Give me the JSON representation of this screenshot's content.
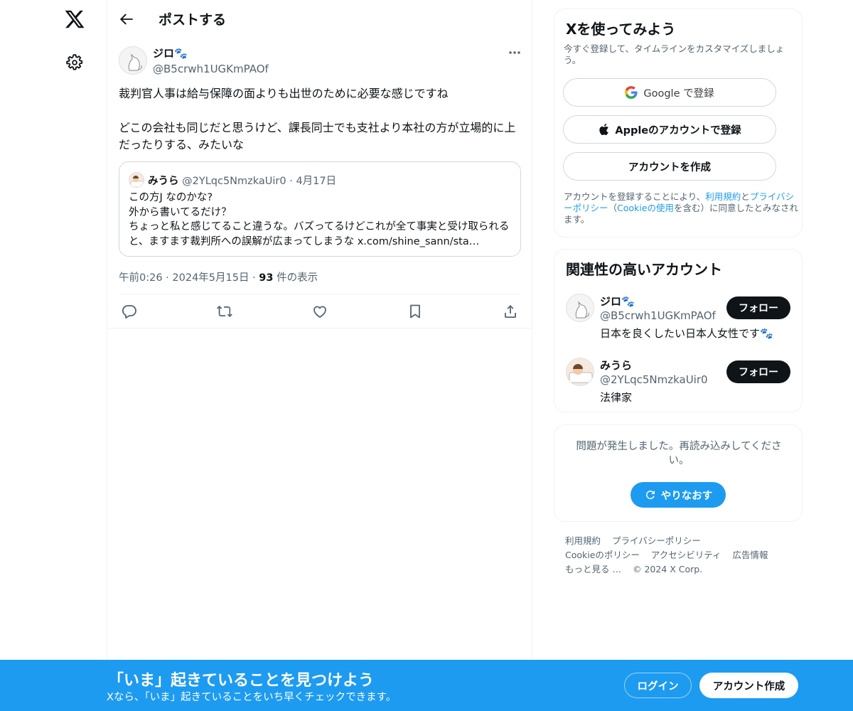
{
  "header": {
    "title": "ポストする"
  },
  "post": {
    "author_name": "ジロ🐾",
    "author_handle": "@B5crwh1UGKmPAOf",
    "text_line1": "裁判官人事は給与保障の面よりも出世のために必要な感じですね",
    "text_line2": "どこの会社も同じだと思うけど、課長同士でも支社より本社の方が立場的に上だったりする、みたいな",
    "quote": {
      "author_name": "みうら",
      "author_handle": "@2YLqc5NmzkaUir0",
      "separator": "·",
      "date": "4月17日",
      "body_line1": "この方J なのかな?",
      "body_line2": "外から書いてるだけ？",
      "body_line3": "ちょっと私と感じてること違うな。バズってるけどこれが全て事実と受け取られると、ますます裁判所への誤解が広まってしまうな x.com/shine_sann/sta…"
    },
    "time": "午前0:26",
    "meta_sep1": "·",
    "date": "2024年5月15日",
    "meta_sep2": "·",
    "views_count": "93",
    "views_label": "件の表示"
  },
  "sidebar": {
    "signup": {
      "title": "Xを使ってみよう",
      "subtitle": "今すぐ登録して、タイムラインをカスタマイズしましょう。",
      "google_label": "Google で登録",
      "apple_label": "Appleのアカウントで登録",
      "create_label": "アカウントを作成",
      "terms_prefix": "アカウントを登録することにより、",
      "terms_link": "利用規約",
      "terms_and": "と",
      "privacy_link": "プライバシーポリシー",
      "terms_mid": "（",
      "cookie_link": "Cookieの使用",
      "terms_suffix": "を含む）に同意したとみなされます。"
    },
    "relevant": {
      "title": "関連性の高いアカウント",
      "accounts": [
        {
          "name": "ジロ🐾",
          "handle": "@B5crwh1UGKmPAOf",
          "bio": "日本を良くしたい日本人女性です🐾",
          "follow_label": "フォロー"
        },
        {
          "name": "みうら",
          "handle": "@2YLqc5NmzkaUir0",
          "bio": "法律家",
          "follow_label": "フォロー"
        }
      ]
    },
    "error": {
      "message": "問題が発生しました。再読み込みしてください。",
      "retry_label": "やりなおす"
    },
    "footer": {
      "terms": "利用規約",
      "privacy": "プライバシーポリシー",
      "cookie": "Cookieのポリシー",
      "accessibility": "アクセシビリティ",
      "ads": "広告情報",
      "more": "もっと見る …",
      "copyright": "© 2024 X Corp."
    }
  },
  "banner": {
    "title": "「いま」起きていることを見つけよう",
    "subtitle": "Xなら、「いま」起きていることをいち早くチェックできます。",
    "login_label": "ログイン",
    "signup_label": "アカウント作成"
  },
  "colors": {
    "accent": "#1d9bf0",
    "text": "#0f1419",
    "secondary": "#536471",
    "border": "#eff3f4"
  }
}
